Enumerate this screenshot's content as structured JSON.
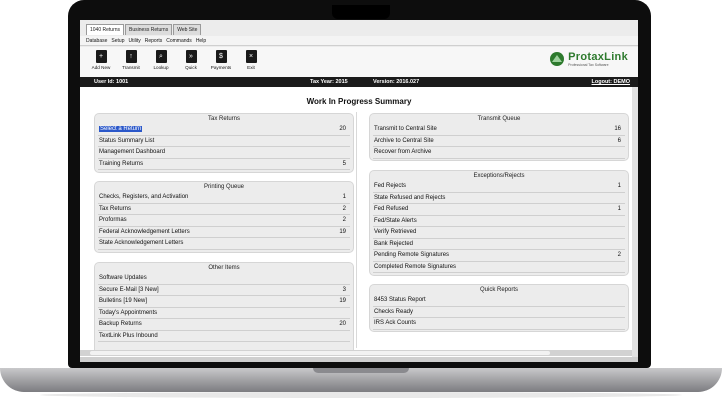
{
  "tabs": [
    "1040 Returns",
    "Business Returns",
    "Web Site"
  ],
  "menu": [
    "Database",
    "Setup",
    "Utility",
    "Reports",
    "Commands",
    "Help"
  ],
  "toolbar": [
    {
      "label": "Add New",
      "icon": "add-new-icon"
    },
    {
      "label": "Transmit",
      "icon": "transmit-icon"
    },
    {
      "label": "Lookup",
      "icon": "lookup-icon"
    },
    {
      "label": "Quick",
      "icon": "quick-icon"
    },
    {
      "label": "Payments",
      "icon": "payments-icon"
    },
    {
      "label": "Exit",
      "icon": "exit-icon"
    }
  ],
  "brand": {
    "name": "ProtaxLink",
    "tagline": "Professional Tax Software",
    "color": "#2d7a2d"
  },
  "info": {
    "user": "User Id:  1001",
    "tax_year": "Tax Year:  2015",
    "version": "Version:  2016.027",
    "logout": "Logout:  DEMO"
  },
  "title": "Work In Progress Summary",
  "colors": {
    "selection": "#2a57c9",
    "infobar": "#1b1b1b"
  },
  "panels": {
    "tax_returns": {
      "title": "Tax Returns",
      "rows": [
        {
          "label": "Select a Return",
          "count": "20"
        },
        {
          "label": "Status Summary List",
          "count": ""
        },
        {
          "label": "Management Dashboard",
          "count": ""
        },
        {
          "label": "Training Returns",
          "count": "5"
        }
      ]
    },
    "printing_queue": {
      "title": "Printing Queue",
      "rows": [
        {
          "label": "Checks, Registers, and Activation",
          "count": "1"
        },
        {
          "label": "Tax Returns",
          "count": "2"
        },
        {
          "label": "Proformas",
          "count": "2"
        },
        {
          "label": "Federal Acknowledgement Letters",
          "count": "19"
        },
        {
          "label": "State Acknowledgement Letters",
          "count": ""
        }
      ]
    },
    "other_items": {
      "title": "Other Items",
      "rows": [
        {
          "label": "Software Updates",
          "count": ""
        },
        {
          "label": "Secure E-Mail  [3 New]",
          "count": "3"
        },
        {
          "label": "Bulletins  [19 New]",
          "count": "19"
        },
        {
          "label": "Today's Appointments",
          "count": ""
        },
        {
          "label": "Backup Returns",
          "count": "20"
        },
        {
          "label": "TextLink Plus Inbound",
          "count": ""
        }
      ]
    },
    "transmit_queue": {
      "title": "Transmit Queue",
      "rows": [
        {
          "label": "Transmit to Central Site",
          "count": "16"
        },
        {
          "label": "Archive to Central Site",
          "count": "6"
        },
        {
          "label": "Recover from Archive",
          "count": ""
        }
      ]
    },
    "exceptions": {
      "title": "Exceptions/Rejects",
      "rows": [
        {
          "label": "Fed Rejects",
          "count": "1"
        },
        {
          "label": "State Refused and Rejects",
          "count": ""
        },
        {
          "label": "Fed Refused",
          "count": "1"
        },
        {
          "label": "Fed/State Alerts",
          "count": ""
        },
        {
          "label": "Verify Retrieved",
          "count": ""
        },
        {
          "label": "Bank Rejected",
          "count": ""
        },
        {
          "label": "Pending Remote Signatures",
          "count": "2"
        },
        {
          "label": "Completed Remote Signatures",
          "count": ""
        }
      ]
    },
    "quick_reports": {
      "title": "Quick Reports",
      "rows": [
        {
          "label": "8453 Status Report",
          "count": ""
        },
        {
          "label": "Checks Ready",
          "count": ""
        },
        {
          "label": "IRS Ack Counts",
          "count": ""
        }
      ]
    }
  }
}
